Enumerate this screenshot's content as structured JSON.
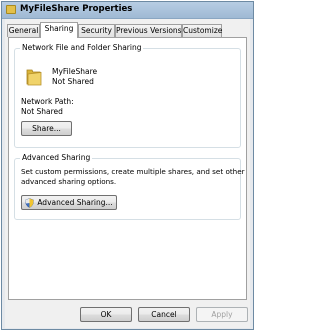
{
  "window": {
    "title": "MyFileShare Properties"
  },
  "tabs": [
    {
      "label": "General",
      "active": false
    },
    {
      "label": "Sharing",
      "active": true
    },
    {
      "label": "Security",
      "active": false
    },
    {
      "label": "Previous Versions",
      "active": false
    },
    {
      "label": "Customize",
      "active": false
    }
  ],
  "network_sharing": {
    "group_label": "Network File and Folder Sharing",
    "folder_name": "MyFileShare",
    "status": "Not Shared",
    "path_label": "Network Path:",
    "path_value": "Not Shared",
    "share_button": "Share..."
  },
  "advanced_sharing": {
    "group_label": "Advanced Sharing",
    "description_line1": "Set custom permissions, create multiple shares, and set other",
    "description_line2": "advanced sharing options.",
    "button": "Advanced Sharing..."
  },
  "footer": {
    "ok": "OK",
    "cancel": "Cancel",
    "apply": "Apply"
  },
  "icons": {
    "title": "folder-icon",
    "folder": "folder-icon",
    "shield": "uac-shield-icon"
  }
}
